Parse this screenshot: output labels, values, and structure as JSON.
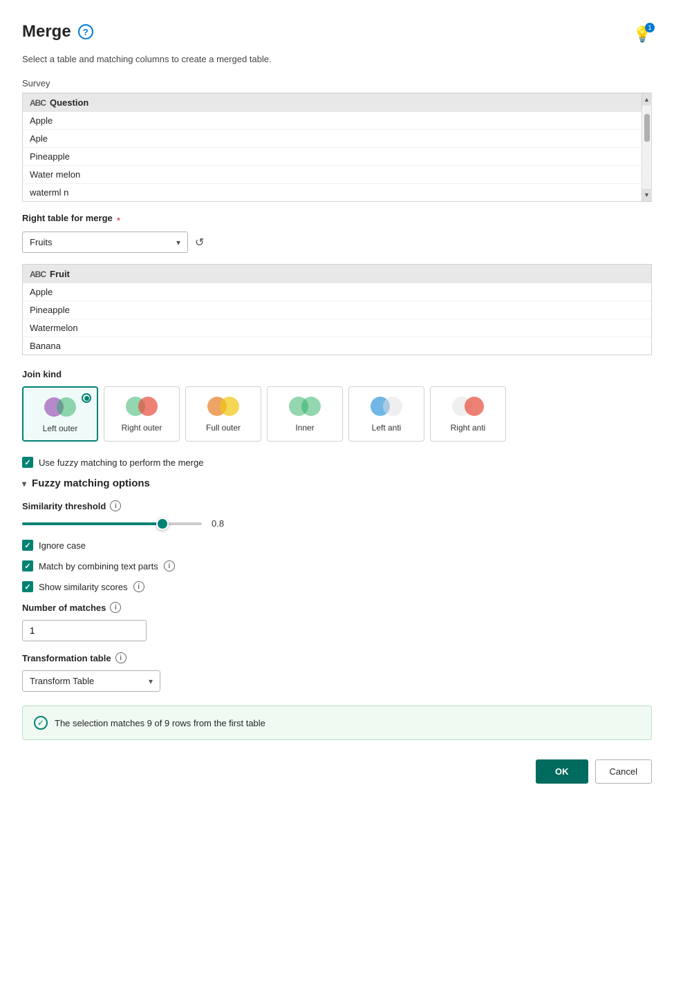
{
  "page": {
    "title": "Merge",
    "subtitle": "Select a table and matching columns to create a merged table.",
    "help_icon": "?",
    "bulb_badge": "1"
  },
  "left_table": {
    "label": "Survey",
    "column": "Question",
    "rows": [
      "Apple",
      "Aple",
      "Pineapple",
      "Water melon",
      "waterml n"
    ]
  },
  "right_table": {
    "label": "Right table for merge",
    "required_marker": "*",
    "selected": "Fruits",
    "dropdown_options": [
      "Fruits"
    ],
    "column": "Fruit",
    "rows": [
      "Apple",
      "Pineapple",
      "Watermelon",
      "Banana"
    ]
  },
  "join_kind": {
    "label": "Join kind",
    "options": [
      {
        "id": "left-outer",
        "label": "Left outer",
        "selected": true
      },
      {
        "id": "right-outer",
        "label": "Right outer",
        "selected": false
      },
      {
        "id": "full-outer",
        "label": "Full outer",
        "selected": false
      },
      {
        "id": "inner",
        "label": "Inner",
        "selected": false
      },
      {
        "id": "left-anti",
        "label": "Left anti",
        "selected": false
      },
      {
        "id": "right-anti",
        "label": "Right anti",
        "selected": false
      }
    ]
  },
  "fuzzy_checkbox": {
    "label": "Use fuzzy matching to perform the merge",
    "checked": true
  },
  "fuzzy_section": {
    "title": "Fuzzy matching options",
    "similarity_threshold": {
      "label": "Similarity threshold",
      "value": 0.8,
      "display": "0.8"
    },
    "ignore_case": {
      "label": "Ignore case",
      "checked": true
    },
    "match_by_combining": {
      "label": "Match by combining text parts",
      "checked": true
    },
    "show_similarity": {
      "label": "Show similarity scores",
      "checked": true
    },
    "number_of_matches": {
      "label": "Number of matches",
      "value": "1"
    },
    "transformation_table": {
      "label": "Transformation table",
      "selected": "Transform Table"
    }
  },
  "success_banner": {
    "message": "The selection matches 9 of 9 rows from the first table"
  },
  "footer": {
    "ok_label": "OK",
    "cancel_label": "Cancel"
  }
}
